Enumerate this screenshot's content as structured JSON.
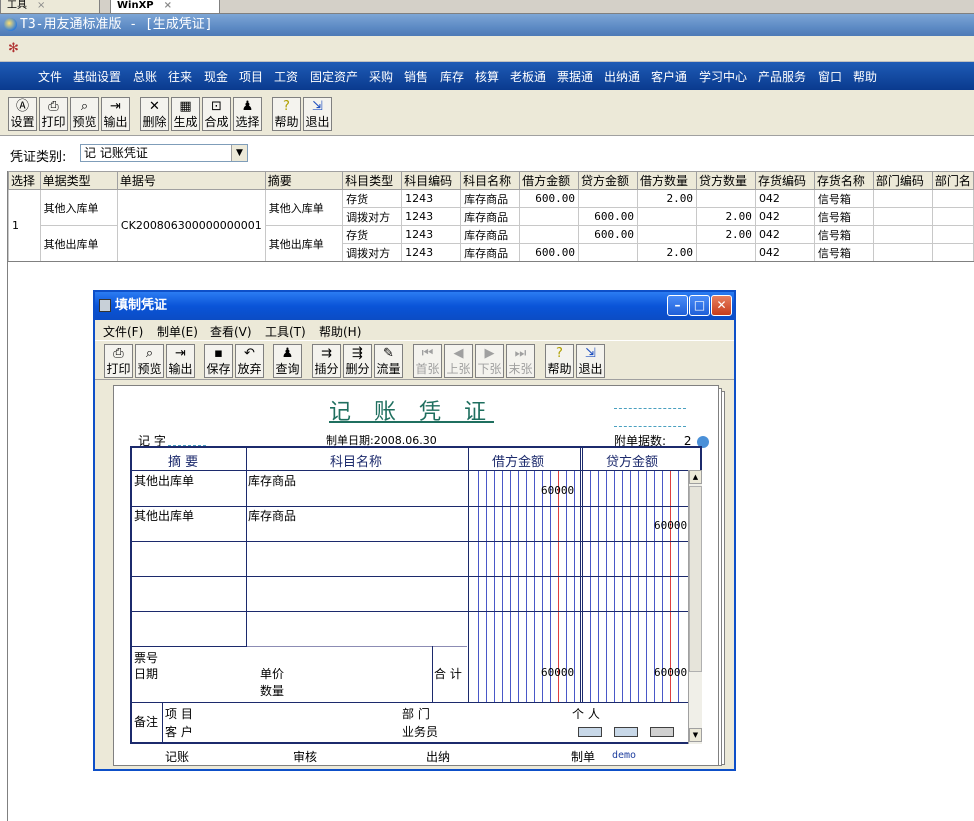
{
  "os_tabs": [
    {
      "label": "工具",
      "close": "×"
    },
    {
      "label": "WinXP",
      "close": "×"
    }
  ],
  "app": {
    "title": "T3-用友通标准版 - [生成凭证]"
  },
  "menu": [
    "文件",
    "基础设置",
    "总账",
    "往来",
    "现金",
    "项目",
    "工资",
    "固定资产",
    "采购",
    "销售",
    "库存",
    "核算",
    "老板通",
    "票据通",
    "出纳通",
    "客户通",
    "学习中心",
    "产品服务",
    "窗口",
    "帮助"
  ],
  "toolbar": [
    {
      "label": "设置",
      "icon": "settings-icon"
    },
    {
      "label": "打印",
      "icon": "print-icon"
    },
    {
      "label": "预览",
      "icon": "preview-icon"
    },
    {
      "label": "输出",
      "icon": "export-icon"
    },
    {
      "label": "删除",
      "icon": "delete-icon"
    },
    {
      "label": "生成",
      "icon": "generate-icon"
    },
    {
      "label": "合成",
      "icon": "merge-icon"
    },
    {
      "label": "选择",
      "icon": "select-icon"
    },
    {
      "label": "帮助",
      "icon": "help-icon"
    },
    {
      "label": "退出",
      "icon": "exit-icon"
    }
  ],
  "filter": {
    "label": "凭证类别:",
    "value": "记 记账凭证"
  },
  "grid": {
    "headers": [
      "选择",
      "单据类型",
      "单据号",
      "摘要",
      "科目类型",
      "科目编码",
      "科目名称",
      "借方金额",
      "贷方金额",
      "借方数量",
      "贷方数量",
      "存货编码",
      "存货名称",
      "部门编码",
      "部门名"
    ],
    "select_value": "1",
    "doc_no": "CK200806300000000001",
    "groups": [
      {
        "type": "其他入库单",
        "summary": "其他入库单"
      },
      {
        "type": "其他出库单",
        "summary": "其他出库单"
      }
    ],
    "rows": [
      {
        "subj_type": "存货",
        "code": "1243",
        "name": "库存商品",
        "debit": "600.00",
        "credit": "",
        "dqty": "2.00",
        "cqty": "",
        "inv_code": "042",
        "inv_name": "信号箱"
      },
      {
        "subj_type": "调拨对方",
        "code": "1243",
        "name": "库存商品",
        "debit": "",
        "credit": "600.00",
        "dqty": "",
        "cqty": "2.00",
        "inv_code": "042",
        "inv_name": "信号箱"
      },
      {
        "subj_type": "存货",
        "code": "1243",
        "name": "库存商品",
        "debit": "",
        "credit": "600.00",
        "dqty": "",
        "cqty": "2.00",
        "inv_code": "042",
        "inv_name": "信号箱"
      },
      {
        "subj_type": "调拨对方",
        "code": "1243",
        "name": "库存商品",
        "debit": "600.00",
        "credit": "",
        "dqty": "2.00",
        "cqty": "",
        "inv_code": "042",
        "inv_name": "信号箱"
      }
    ]
  },
  "dialog": {
    "title": "填制凭证",
    "menu": [
      "文件(F)",
      "制单(E)",
      "查看(V)",
      "工具(T)",
      "帮助(H)"
    ],
    "toolbar": [
      {
        "label": "打印",
        "enabled": true
      },
      {
        "label": "预览",
        "enabled": true
      },
      {
        "label": "输出",
        "enabled": true
      },
      {
        "label": "保存",
        "enabled": true
      },
      {
        "label": "放弃",
        "enabled": true
      },
      {
        "label": "查询",
        "enabled": true
      },
      {
        "label": "插分",
        "enabled": true
      },
      {
        "label": "删分",
        "enabled": true
      },
      {
        "label": "流量",
        "enabled": true
      },
      {
        "label": "首张",
        "enabled": false
      },
      {
        "label": "上张",
        "enabled": false
      },
      {
        "label": "下张",
        "enabled": false
      },
      {
        "label": "末张",
        "enabled": false
      },
      {
        "label": "帮助",
        "enabled": true
      },
      {
        "label": "退出",
        "enabled": true
      }
    ]
  },
  "voucher": {
    "title": "记 账 凭 证",
    "word": "记 字",
    "date_label": "制单日期:",
    "date": "2008.06.30",
    "attach_label": "附单据数:",
    "attach_count": "2",
    "col_summary": "摘 要",
    "col_subject": "科目名称",
    "col_debit": "借方金额",
    "col_credit": "贷方金额",
    "lines": [
      {
        "summary": "其他出库单",
        "subject": "库存商品",
        "debit": "60000",
        "credit": ""
      },
      {
        "summary": "其他出库单",
        "subject": "库存商品",
        "debit": "",
        "credit": "60000"
      }
    ],
    "ticket_label": "票号",
    "ticket_date_label": "日期",
    "unit_price_label": "单价",
    "qty_label": "数量",
    "total_label": "合 计",
    "total_debit": "60000",
    "total_credit": "60000",
    "remark_label": "备注",
    "project_label": "项 目",
    "customer_label": "客 户",
    "dept_label": "部 门",
    "salesman_label": "业务员",
    "person_label": "个 人",
    "footer": {
      "bookkeeper": "记账",
      "auditor": "审核",
      "cashier": "出纳",
      "maker_label": "制单",
      "maker": "demo"
    }
  }
}
